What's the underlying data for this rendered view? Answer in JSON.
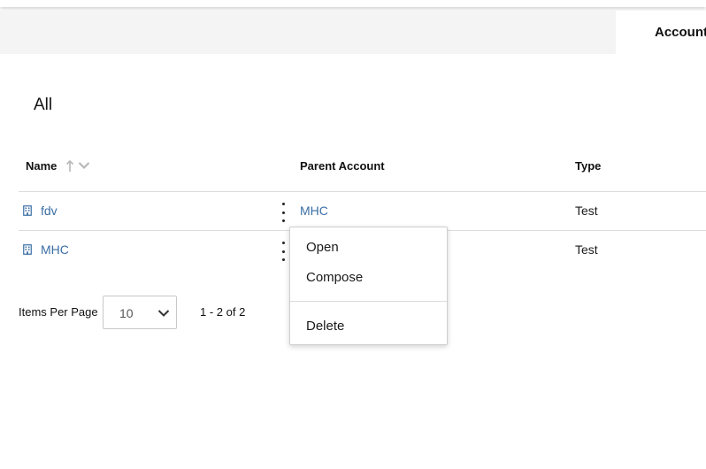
{
  "header": {
    "active_tab_label": "Account"
  },
  "view": {
    "title": "All"
  },
  "table": {
    "columns": [
      {
        "label": "Name"
      },
      {
        "label": "Parent Account"
      },
      {
        "label": "Type"
      }
    ],
    "rows": [
      {
        "name": "fdv",
        "parent": "MHC",
        "type": "Test",
        "icon": "building-icon"
      },
      {
        "name": "MHC",
        "parent": "",
        "type": "Test",
        "icon": "building-icon"
      }
    ]
  },
  "context_menu": {
    "items": [
      {
        "label": "Open"
      },
      {
        "label": "Compose"
      },
      {
        "label": "Delete"
      }
    ]
  },
  "pagination": {
    "items_per_page_label": "Items Per Page",
    "items_per_page_value": "10",
    "range_text": "1 - 2 of 2"
  },
  "colors": {
    "link": "#3a6ea5",
    "tabstrip_bg": "#f4f4f4",
    "divider": "#dcdcdc"
  }
}
